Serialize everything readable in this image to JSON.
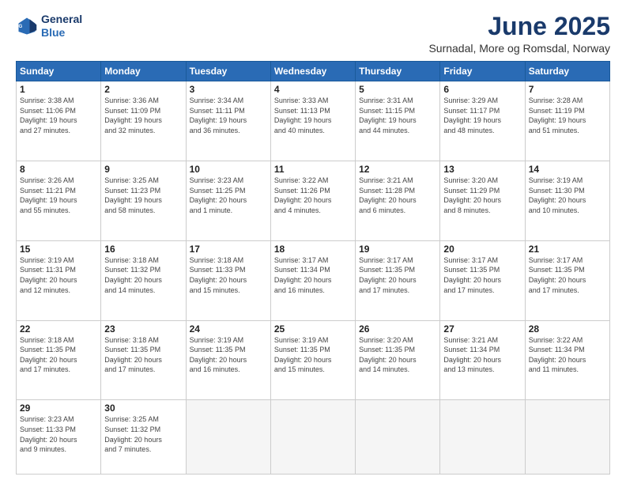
{
  "header": {
    "logo_line1": "General",
    "logo_line2": "Blue",
    "title": "June 2025",
    "subtitle": "Surnadal, More og Romsdal, Norway"
  },
  "columns": [
    "Sunday",
    "Monday",
    "Tuesday",
    "Wednesday",
    "Thursday",
    "Friday",
    "Saturday"
  ],
  "weeks": [
    [
      {
        "day": "1",
        "info": "Sunrise: 3:38 AM\nSunset: 11:06 PM\nDaylight: 19 hours\nand 27 minutes."
      },
      {
        "day": "2",
        "info": "Sunrise: 3:36 AM\nSunset: 11:09 PM\nDaylight: 19 hours\nand 32 minutes."
      },
      {
        "day": "3",
        "info": "Sunrise: 3:34 AM\nSunset: 11:11 PM\nDaylight: 19 hours\nand 36 minutes."
      },
      {
        "day": "4",
        "info": "Sunrise: 3:33 AM\nSunset: 11:13 PM\nDaylight: 19 hours\nand 40 minutes."
      },
      {
        "day": "5",
        "info": "Sunrise: 3:31 AM\nSunset: 11:15 PM\nDaylight: 19 hours\nand 44 minutes."
      },
      {
        "day": "6",
        "info": "Sunrise: 3:29 AM\nSunset: 11:17 PM\nDaylight: 19 hours\nand 48 minutes."
      },
      {
        "day": "7",
        "info": "Sunrise: 3:28 AM\nSunset: 11:19 PM\nDaylight: 19 hours\nand 51 minutes."
      }
    ],
    [
      {
        "day": "8",
        "info": "Sunrise: 3:26 AM\nSunset: 11:21 PM\nDaylight: 19 hours\nand 55 minutes."
      },
      {
        "day": "9",
        "info": "Sunrise: 3:25 AM\nSunset: 11:23 PM\nDaylight: 19 hours\nand 58 minutes."
      },
      {
        "day": "10",
        "info": "Sunrise: 3:23 AM\nSunset: 11:25 PM\nDaylight: 20 hours\nand 1 minute."
      },
      {
        "day": "11",
        "info": "Sunrise: 3:22 AM\nSunset: 11:26 PM\nDaylight: 20 hours\nand 4 minutes."
      },
      {
        "day": "12",
        "info": "Sunrise: 3:21 AM\nSunset: 11:28 PM\nDaylight: 20 hours\nand 6 minutes."
      },
      {
        "day": "13",
        "info": "Sunrise: 3:20 AM\nSunset: 11:29 PM\nDaylight: 20 hours\nand 8 minutes."
      },
      {
        "day": "14",
        "info": "Sunrise: 3:19 AM\nSunset: 11:30 PM\nDaylight: 20 hours\nand 10 minutes."
      }
    ],
    [
      {
        "day": "15",
        "info": "Sunrise: 3:19 AM\nSunset: 11:31 PM\nDaylight: 20 hours\nand 12 minutes."
      },
      {
        "day": "16",
        "info": "Sunrise: 3:18 AM\nSunset: 11:32 PM\nDaylight: 20 hours\nand 14 minutes."
      },
      {
        "day": "17",
        "info": "Sunrise: 3:18 AM\nSunset: 11:33 PM\nDaylight: 20 hours\nand 15 minutes."
      },
      {
        "day": "18",
        "info": "Sunrise: 3:17 AM\nSunset: 11:34 PM\nDaylight: 20 hours\nand 16 minutes."
      },
      {
        "day": "19",
        "info": "Sunrise: 3:17 AM\nSunset: 11:35 PM\nDaylight: 20 hours\nand 17 minutes."
      },
      {
        "day": "20",
        "info": "Sunrise: 3:17 AM\nSunset: 11:35 PM\nDaylight: 20 hours\nand 17 minutes."
      },
      {
        "day": "21",
        "info": "Sunrise: 3:17 AM\nSunset: 11:35 PM\nDaylight: 20 hours\nand 17 minutes."
      }
    ],
    [
      {
        "day": "22",
        "info": "Sunrise: 3:18 AM\nSunset: 11:35 PM\nDaylight: 20 hours\nand 17 minutes."
      },
      {
        "day": "23",
        "info": "Sunrise: 3:18 AM\nSunset: 11:35 PM\nDaylight: 20 hours\nand 17 minutes."
      },
      {
        "day": "24",
        "info": "Sunrise: 3:19 AM\nSunset: 11:35 PM\nDaylight: 20 hours\nand 16 minutes."
      },
      {
        "day": "25",
        "info": "Sunrise: 3:19 AM\nSunset: 11:35 PM\nDaylight: 20 hours\nand 15 minutes."
      },
      {
        "day": "26",
        "info": "Sunrise: 3:20 AM\nSunset: 11:35 PM\nDaylight: 20 hours\nand 14 minutes."
      },
      {
        "day": "27",
        "info": "Sunrise: 3:21 AM\nSunset: 11:34 PM\nDaylight: 20 hours\nand 13 minutes."
      },
      {
        "day": "28",
        "info": "Sunrise: 3:22 AM\nSunset: 11:34 PM\nDaylight: 20 hours\nand 11 minutes."
      }
    ],
    [
      {
        "day": "29",
        "info": "Sunrise: 3:23 AM\nSunset: 11:33 PM\nDaylight: 20 hours\nand 9 minutes."
      },
      {
        "day": "30",
        "info": "Sunrise: 3:25 AM\nSunset: 11:32 PM\nDaylight: 20 hours\nand 7 minutes."
      },
      {
        "day": "",
        "info": ""
      },
      {
        "day": "",
        "info": ""
      },
      {
        "day": "",
        "info": ""
      },
      {
        "day": "",
        "info": ""
      },
      {
        "day": "",
        "info": ""
      }
    ]
  ]
}
